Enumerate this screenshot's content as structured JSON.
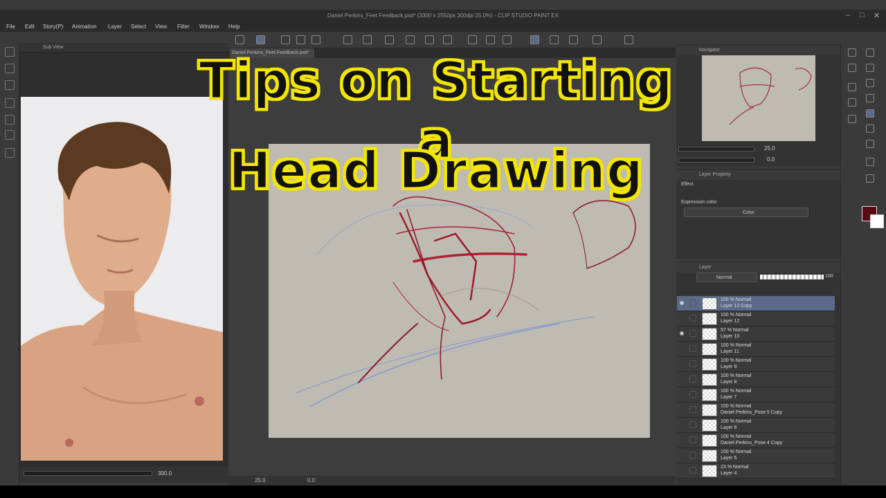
{
  "window": {
    "title": "Daniel Perkins_Feet Feedback.psd* (3300 x 2550px 300dpi 25.0%)  - CLIP STUDIO PAINT EX"
  },
  "menu": [
    "File",
    "Edit",
    "Story(P)",
    "Animation",
    "Layer",
    "Select",
    "View",
    "Filter",
    "Window",
    "Help"
  ],
  "sub_view": {
    "title": "Sub View",
    "zoom": "300.0"
  },
  "canvas": {
    "tab_label": "Daniel Perkins_Feet Feedback.psd*",
    "zoom": "25.0",
    "rotation": "0.0"
  },
  "overlay_title": {
    "line1": "Tips on Starting a",
    "line2": "Head Drawing"
  },
  "navigator": {
    "title": "Navigator",
    "zoom": "25.0",
    "rotation": "0.0"
  },
  "layer_property": {
    "title": "Layer Property",
    "effect_label": "Effect",
    "expression_color_label": "Expression color",
    "expression_color_value": "Color"
  },
  "layers_panel": {
    "title": "Layer",
    "blend_mode": "Normal",
    "opacity": "100",
    "layers": [
      {
        "mode": "100 % Normal",
        "name": "Layer 12 Copy",
        "visible": true,
        "selected": true
      },
      {
        "mode": "100 % Normal",
        "name": "Layer 12",
        "visible": false,
        "selected": false
      },
      {
        "mode": "57 % Normal",
        "name": "Layer 10",
        "visible": true,
        "selected": false
      },
      {
        "mode": "100 % Normal",
        "name": "Layer 11",
        "visible": false,
        "selected": false
      },
      {
        "mode": "100 % Normal",
        "name": "Layer 9",
        "visible": false,
        "selected": false
      },
      {
        "mode": "100 % Normal",
        "name": "Layer 8",
        "visible": false,
        "selected": false
      },
      {
        "mode": "100 % Normal",
        "name": "Layer 7",
        "visible": false,
        "selected": false
      },
      {
        "mode": "100 % Normal",
        "name": "Daniel Perkins_Pose 5 Copy",
        "visible": false,
        "selected": false
      },
      {
        "mode": "100 % Normal",
        "name": "Layer 6",
        "visible": false,
        "selected": false
      },
      {
        "mode": "100 % Normal",
        "name": "Daniel Perkins_Pose 4 Copy",
        "visible": false,
        "selected": false
      },
      {
        "mode": "100 % Normal",
        "name": "Layer 5",
        "visible": false,
        "selected": false
      },
      {
        "mode": "23 % Normal",
        "name": "Layer 4",
        "visible": false,
        "selected": false
      }
    ]
  },
  "colors": {
    "main_color": "#5a0a12",
    "sub_color": "#ffffff",
    "selected_layer": "#5a6a88",
    "title_fill": "#111111",
    "title_outline": "#f2e600"
  }
}
